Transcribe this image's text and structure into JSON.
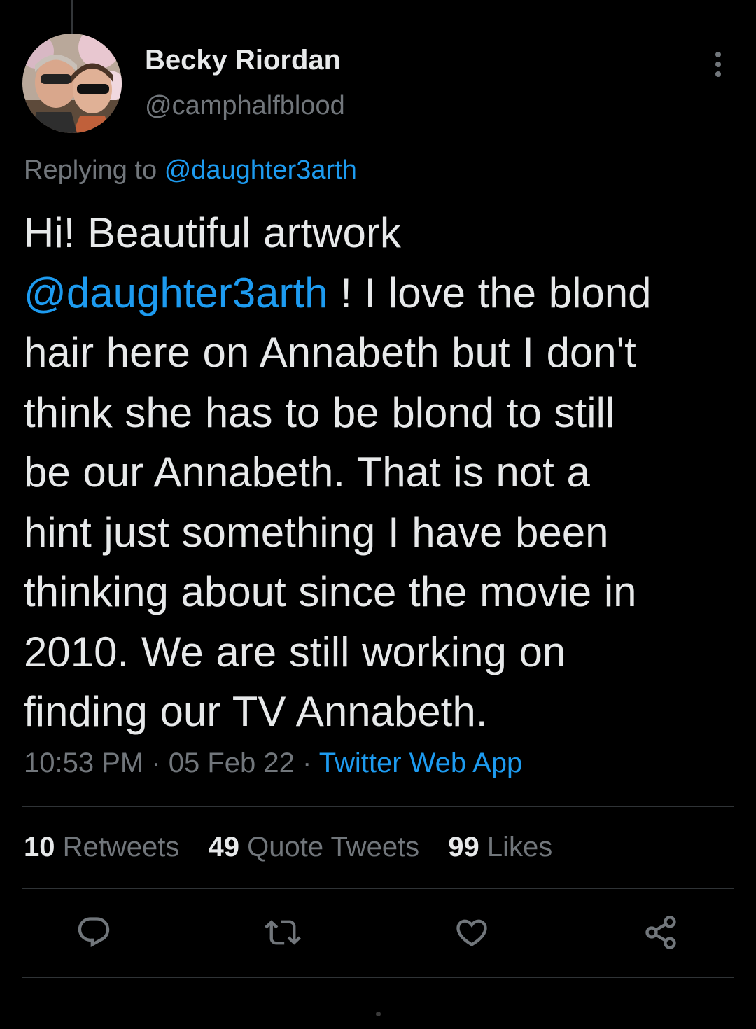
{
  "author": {
    "name": "Becky Riordan",
    "handle": "@camphalfblood"
  },
  "reply_context": {
    "prefix": "Replying to",
    "mention": "@daughter3arth"
  },
  "tweet": {
    "line1": "Hi!  Beautiful artwork",
    "mention": "@daughter3arth",
    "line2_rest": " !  I love the blond",
    "line3": "hair here on Annabeth but I don't",
    "line4": "think she has to be blond to still",
    "line5": "be our Annabeth. That is not a",
    "line6": "hint just something I have been",
    "line7": "thinking about since the movie in",
    "line8": "2010. We are still working on",
    "line9": "finding our TV Annabeth."
  },
  "meta": {
    "time": "10:53 PM",
    "separator": " · ",
    "date": "05 Feb 22",
    "source": "Twitter Web App"
  },
  "stats": {
    "retweets_count": "10",
    "retweets_label": " Retweets",
    "quotes_count": "49",
    "quotes_label": " Quote Tweets",
    "likes_count": "99",
    "likes_label": " Likes"
  },
  "actions": {
    "reply_icon": "reply-icon",
    "retweet_icon": "retweet-icon",
    "like_icon": "heart-icon",
    "share_icon": "share-icon"
  },
  "colors": {
    "background": "#000000",
    "text": "#e7e9ea",
    "muted": "#71767b",
    "link": "#1d9bf0",
    "divider": "#2f3336"
  }
}
